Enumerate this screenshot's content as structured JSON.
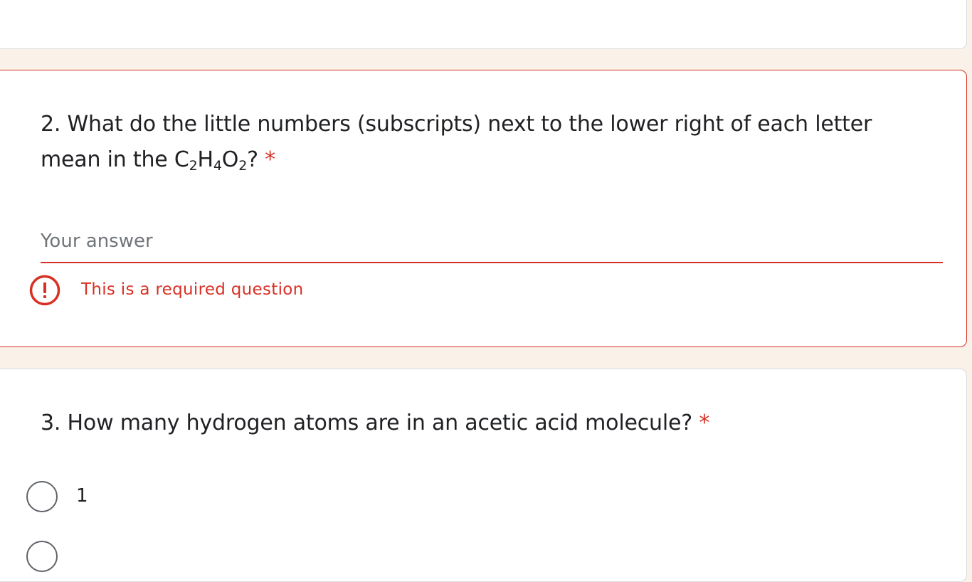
{
  "question2": {
    "title_main": "2. What do the little numbers (subscripts) next to the lower right of each letter mean in the C",
    "formula": [
      {
        "sym": "H",
        "sub": "4"
      },
      {
        "sym": "O",
        "sub": "2"
      }
    ],
    "formula_first_sub": "2",
    "title_end": "?",
    "required_marker": "*",
    "input_placeholder": "Your answer",
    "input_value": "",
    "error_text": "This is a required question"
  },
  "question3": {
    "title": "3. How many hydrogen atoms are in an acetic acid molecule?",
    "required_marker": "*",
    "options": [
      {
        "label": "1"
      }
    ]
  },
  "colors": {
    "error": "#d93025",
    "background": "#faf1e8",
    "card": "#ffffff"
  },
  "icons": {
    "error": "error-circle-exclamation-icon"
  }
}
